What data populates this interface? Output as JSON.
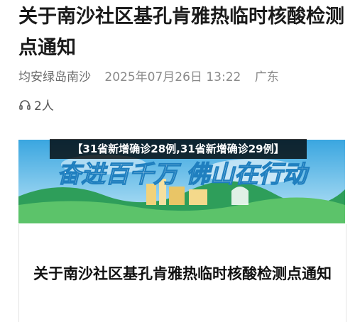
{
  "article": {
    "title": "关于南沙社区基孔肯雅热临时核酸检测点通知",
    "author": "均安绿岛南沙",
    "datetime": "2025年07月26日 13:22",
    "location": "广东",
    "listeners": "2人"
  },
  "overlay": {
    "caption": "【31省新增确诊28例,31省新增确诊29例】"
  },
  "banner": {
    "slogan": "奋进百千万 佛山在行动",
    "colors": {
      "sky": "#4fb3e6",
      "grass": "#2e9e5a",
      "text": "#ffffff"
    }
  },
  "card": {
    "title": "关于南沙社区基孔肯雅热临时核酸检测点通知"
  },
  "icons": {
    "listeners": "headphones-icon"
  }
}
